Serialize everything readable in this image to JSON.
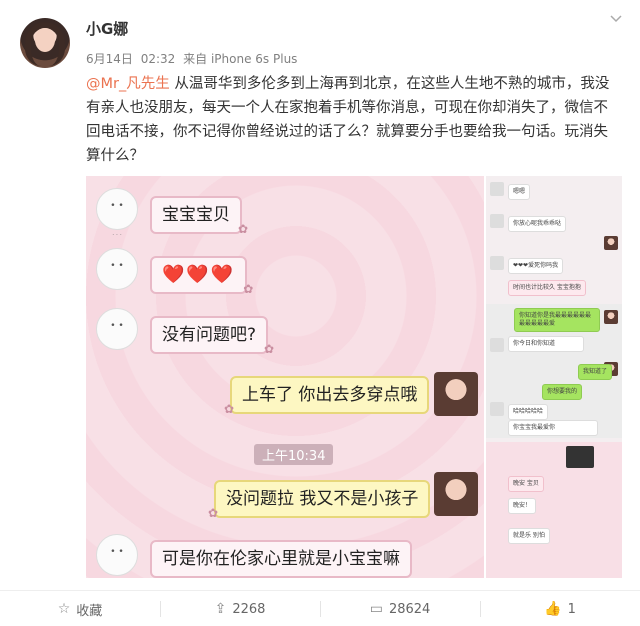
{
  "post": {
    "username": "小G娜",
    "date": "6月14日",
    "time": "02:32",
    "source": "来自 iPhone 6s Plus",
    "mention": "@Mr_凡先生",
    "text": " 从温哥华到多伦多到上海再到北京，在这些人生地不熟的城市，我没有亲人也没朋友，每天一个人在家抱着手机等你消息，可现在你却消失了，微信不回电话不接，你不记得你曾经说过的话了么？就算要分手也要给我一句话。玩消失算什么？"
  },
  "chat": {
    "msg1": "宝宝宝贝",
    "msg2": "❤️❤️❤️",
    "msg3": "没有问题吧?",
    "msg4": "上车了 你出去多穿点哦",
    "timestamp": "上午10:34",
    "msg5": "没问题拉 我又不是小孩子",
    "msg6": "可是你在伦家心里就是小宝宝嘛"
  },
  "side_chat": {
    "m1": "嗯嗯",
    "m2": "你放心呢我乖乖哒",
    "m3": "❤❤❤爱死你吗我",
    "m4": "时间也计比较久 宝宝抱抱",
    "m5": "你知道你是我最最最最最最最最最最最爱",
    "m6": "你今日和你知道",
    "m7": "刚刚你说什么",
    "m8": "我知道了",
    "m9": "你想要我的",
    "m10": "哈哈哈哈哈",
    "m11": "你宝宝我最爱你",
    "m12": "晚安 宝贝",
    "m13": "就是乐 别怕",
    "m14": "晚安！"
  },
  "actions": {
    "favorite_icon": "star-icon",
    "favorite_label": "收藏",
    "repost_icon": "repost-icon",
    "repost_count": "2268",
    "comment_icon": "comment-icon",
    "comment_count": "28624",
    "like_icon": "thumbs-up-icon",
    "like_count": "1"
  },
  "colors": {
    "mention": "#eb7350",
    "meta": "#808080",
    "bubble_pink": "#fdf3f6",
    "bubble_yellow": "#fdf7c2"
  }
}
